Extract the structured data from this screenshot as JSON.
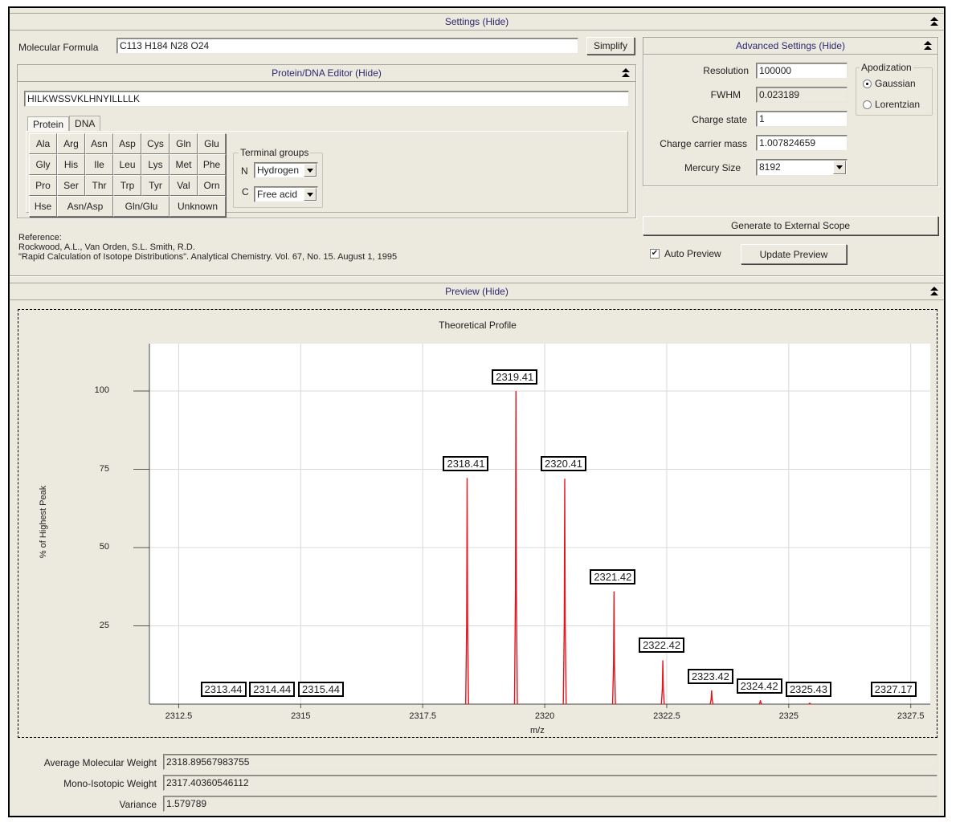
{
  "settings": {
    "title": "Settings (Hide)",
    "molecular_formula_label": "Molecular Formula",
    "molecular_formula_value": "C113 H184 N28 O24",
    "simplify_label": "Simplify"
  },
  "protein_editor": {
    "title": "Protein/DNA Editor (Hide)",
    "sequence": "HILKWSSVKLHNYILLLLK",
    "tabs": [
      {
        "label": "Protein",
        "active": true
      },
      {
        "label": "DNA",
        "active": false
      }
    ],
    "amino_acids_rows": [
      [
        "Ala",
        "Arg",
        "Asn",
        "Asp",
        "Cys",
        "Gln",
        "Glu"
      ],
      [
        "Gly",
        "His",
        "Ile",
        "Leu",
        "Lys",
        "Met",
        "Phe"
      ],
      [
        "Pro",
        "Ser",
        "Thr",
        "Trp",
        "Tyr",
        "Val",
        "Orn"
      ]
    ],
    "last_row": [
      "Hse",
      "Asn/Asp",
      "Gln/Glu",
      "Unknown"
    ],
    "terminal_groups": {
      "legend": "Terminal groups",
      "n_label": "N",
      "n_value": "Hydrogen",
      "c_label": "C",
      "c_value": "Free acid"
    }
  },
  "reference": {
    "heading": "Reference:",
    "authors": "Rockwood, A.L., Van Orden, S.L. Smith, R.D.",
    "citation": "\"Rapid Calculation of Isotope Distributions\". Analytical Chemistry. Vol. 67, No. 15. August 1, 1995"
  },
  "advanced": {
    "title": "Advanced Settings (Hide)",
    "resolution_label": "Resolution",
    "resolution_value": "100000",
    "fwhm_label": "FWHM",
    "fwhm_value": "0.023189",
    "charge_state_label": "Charge state",
    "charge_state_value": "1",
    "carrier_mass_label": "Charge carrier mass",
    "carrier_mass_value": "1.007824659",
    "mercury_size_label": "Mercury Size",
    "mercury_size_value": "8192",
    "apodization": {
      "legend": "Apodization",
      "options": [
        {
          "label": "Gaussian",
          "selected": true
        },
        {
          "label": "Lorentzian",
          "selected": false
        }
      ]
    }
  },
  "actions": {
    "generate_label": "Generate to External Scope",
    "auto_preview_label": "Auto Preview",
    "auto_preview_checked": true,
    "update_preview_label": "Update Preview"
  },
  "preview": {
    "title": "Preview  (Hide)"
  },
  "results": {
    "avg_mw_label": "Average Molecular Weight",
    "avg_mw_value": "2318.89567983755",
    "mono_label": "Mono-Isotopic Weight",
    "mono_value": "2317.40360546112",
    "variance_label": "Variance",
    "variance_value": "1.579789"
  },
  "colors": {
    "peak": "#e8141c",
    "panel": "#ece9df",
    "header_text": "#2a2870"
  },
  "chart_data": {
    "type": "line",
    "title": "Theoretical Profile",
    "xlabel": "m/z",
    "ylabel": "% of Highest Peak",
    "xlim": [
      2311.9,
      2327.9
    ],
    "ylim": [
      0,
      115
    ],
    "xticks": [
      2312.5,
      2315,
      2317.5,
      2320,
      2322.5,
      2325,
      2327.5
    ],
    "xtick_labels": [
      "2312.5",
      "2315",
      "2317.5",
      "2320",
      "2322.5",
      "2325",
      "2327.5"
    ],
    "yticks": [
      25,
      50,
      75,
      100
    ],
    "ytick_labels": [
      "25",
      "50",
      "75",
      "100"
    ],
    "grid": true,
    "series": [
      {
        "name": "Theoretical Profile",
        "color": "#e8141c",
        "peaks": [
          {
            "mz": 2318.41,
            "intensity": 72.2
          },
          {
            "mz": 2319.41,
            "intensity": 100
          },
          {
            "mz": 2320.41,
            "intensity": 72.0
          },
          {
            "mz": 2321.42,
            "intensity": 36.0
          },
          {
            "mz": 2322.42,
            "intensity": 14.0
          },
          {
            "mz": 2323.42,
            "intensity": 4.4
          },
          {
            "mz": 2324.42,
            "intensity": 1.2
          },
          {
            "mz": 2325.43,
            "intensity": 0.3
          }
        ]
      }
    ],
    "annotations": [
      {
        "text": "2313.44",
        "mz": 2313.44,
        "y": 4.5
      },
      {
        "text": "2314.44",
        "mz": 2314.44,
        "y": 4.5
      },
      {
        "text": "2315.44",
        "mz": 2315.44,
        "y": 4.5
      },
      {
        "text": "2318.41",
        "mz": 2318.41,
        "y": 76.7
      },
      {
        "text": "2319.41",
        "mz": 2319.41,
        "y": 104.3
      },
      {
        "text": "2320.41",
        "mz": 2320.41,
        "y": 76.7
      },
      {
        "text": "2321.42",
        "mz": 2321.42,
        "y": 40.4
      },
      {
        "text": "2322.42",
        "mz": 2322.42,
        "y": 18.6
      },
      {
        "text": "2323.42",
        "mz": 2323.42,
        "y": 8.8
      },
      {
        "text": "2324.42",
        "mz": 2324.42,
        "y": 5.6
      },
      {
        "text": "2325.43",
        "mz": 2325.43,
        "y": 4.5
      },
      {
        "text": "2327.17",
        "mz": 2327.17,
        "y": 4.5
      }
    ]
  }
}
